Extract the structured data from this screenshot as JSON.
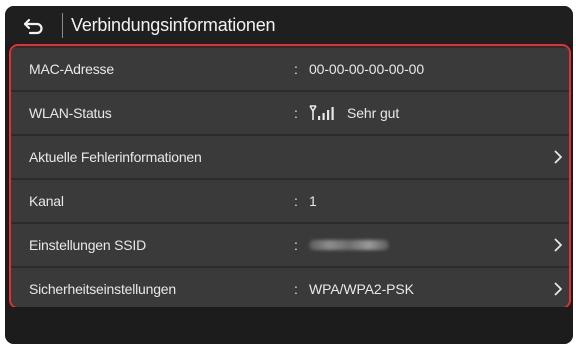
{
  "header": {
    "back_icon": "back-arrow-icon",
    "title": "Verbindungsinformationen"
  },
  "rows": [
    {
      "label": "MAC-Adresse",
      "colon": ":",
      "value": "00-00-00-00-00-00",
      "chevron": false
    },
    {
      "label": "WLAN-Status",
      "colon": ":",
      "value": "Sehr gut",
      "icon": "wifi-signal-icon",
      "chevron": false
    },
    {
      "label": "Aktuelle Fehlerinformationen",
      "colon": "",
      "value": "",
      "chevron": true
    },
    {
      "label": "Kanal",
      "colon": ":",
      "value": "1",
      "chevron": false
    },
    {
      "label": "Einstellungen SSID",
      "colon": ":",
      "value": "",
      "value_obscured": true,
      "chevron": true
    },
    {
      "label": "Sicherheitseinstellungen",
      "colon": ":",
      "value": "WPA/WPA2-PSK",
      "chevron": true
    }
  ],
  "colors": {
    "background": "#1c1c1c",
    "row": "#3a3a3a",
    "highlight_border": "#e53030",
    "text": "#e8e8e8"
  }
}
